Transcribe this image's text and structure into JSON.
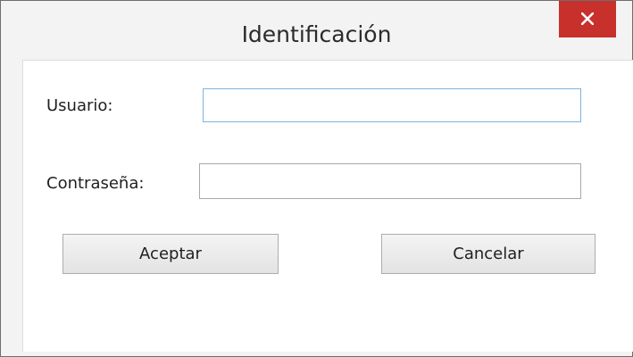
{
  "window": {
    "title": "Identificación",
    "close_icon": "close-icon"
  },
  "form": {
    "user_label": "Usuario:",
    "user_value": "",
    "password_label": "Contraseña:",
    "password_value": ""
  },
  "buttons": {
    "accept_label": "Aceptar",
    "cancel_label": "Cancelar"
  },
  "colors": {
    "close_button": "#c7302b",
    "focus_border": "#7fb4dc"
  }
}
